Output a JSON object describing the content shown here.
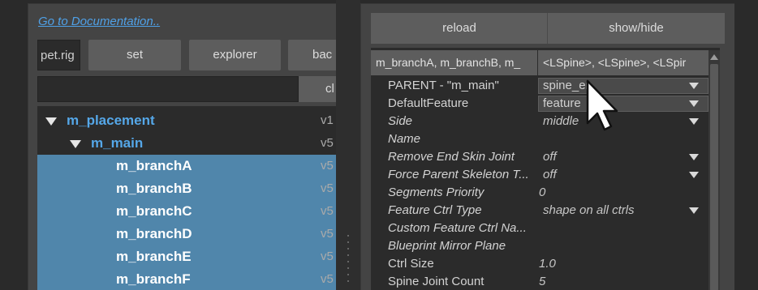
{
  "left": {
    "doc_link": "Go to Documentation..",
    "rig_field_value": "pet.rig",
    "buttons": {
      "set": "set",
      "explorer": "explorer",
      "back": "bac",
      "clear": "cl"
    },
    "tree": [
      {
        "name": "m_placement",
        "version": "v1"
      },
      {
        "name": "m_main",
        "version": "v5"
      },
      {
        "name": "m_branchA",
        "version": "v5"
      },
      {
        "name": "m_branchB",
        "version": "v5"
      },
      {
        "name": "m_branchC",
        "version": "v5"
      },
      {
        "name": "m_branchD",
        "version": "v5"
      },
      {
        "name": "m_branchE",
        "version": "v5"
      },
      {
        "name": "m_branchF",
        "version": "v5"
      }
    ]
  },
  "right": {
    "buttons": {
      "reload": "reload",
      "show_hide": "show/hide"
    },
    "header": {
      "components": "m_branchA, m_branchB, m_",
      "spines": "<LSpine>, <LSpine>, <LSpir"
    },
    "attributes": [
      {
        "label": "PARENT - \"m_main\"",
        "value": "spine_end"
      },
      {
        "label": "DefaultFeature",
        "value": "feature"
      },
      {
        "label": "Side",
        "value": "middle"
      },
      {
        "label": "Name",
        "value": ""
      },
      {
        "label": "Remove End Skin Joint",
        "value": "off"
      },
      {
        "label": "Force Parent Skeleton T...",
        "value": "off"
      },
      {
        "label": "Segments Priority",
        "value": "0"
      },
      {
        "label": "Feature Ctrl Type",
        "value": "shape on all ctrls"
      },
      {
        "label": "Custom Feature Ctrl Na...",
        "value": ""
      },
      {
        "label": "Blueprint Mirror Plane",
        "value": ""
      },
      {
        "label": "Ctrl Size",
        "value": "1.0"
      },
      {
        "label": "Spine Joint Count",
        "value": "5"
      }
    ]
  },
  "colors": {
    "accent_blue": "#55a7e8",
    "selection": "#5086ab",
    "link": "#4fa0e6"
  },
  "icons": [
    "dropdown-arrow-icon",
    "tree-expand-icon",
    "mouse-pointer-icon",
    "scroll-up-icon"
  ]
}
